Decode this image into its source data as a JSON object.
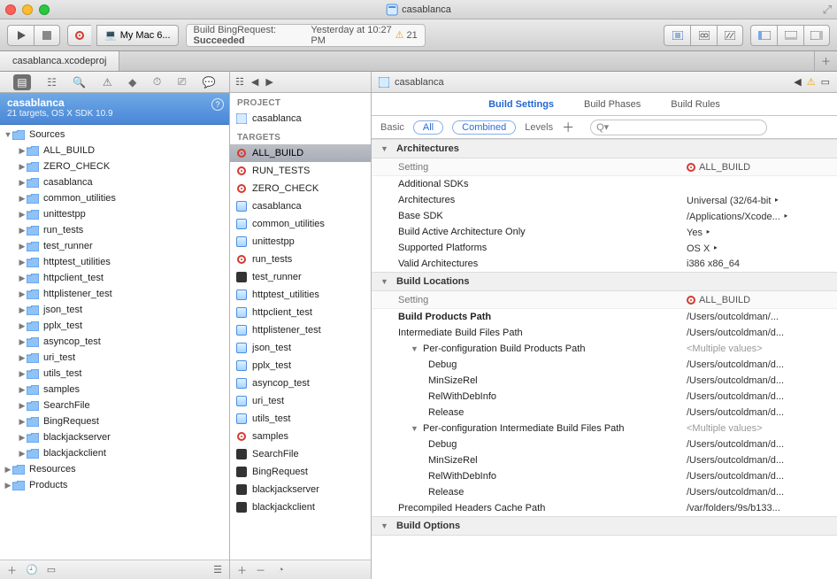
{
  "window": {
    "title": "casablanca"
  },
  "toolbar": {
    "scheme_target": "My Mac 6...",
    "activity_left": "Build BingRequest:",
    "activity_status": "Succeeded",
    "activity_right": "Yesterday at 10:27 PM",
    "warning_count": "21"
  },
  "tabbar": {
    "tab1": "casablanca.xcodeproj"
  },
  "navigator": {
    "project_name": "casablanca",
    "project_sub": "21 targets, OS X SDK 10.9",
    "tree": [
      {
        "label": "Sources",
        "depth": 1,
        "open": true,
        "icon": "folder"
      },
      {
        "label": "ALL_BUILD",
        "depth": 2,
        "icon": "folder"
      },
      {
        "label": "ZERO_CHECK",
        "depth": 2,
        "icon": "folder"
      },
      {
        "label": "casablanca",
        "depth": 2,
        "icon": "folder"
      },
      {
        "label": "common_utilities",
        "depth": 2,
        "icon": "folder"
      },
      {
        "label": "unittestpp",
        "depth": 2,
        "icon": "folder"
      },
      {
        "label": "run_tests",
        "depth": 2,
        "icon": "folder"
      },
      {
        "label": "test_runner",
        "depth": 2,
        "icon": "folder"
      },
      {
        "label": "httptest_utilities",
        "depth": 2,
        "icon": "folder"
      },
      {
        "label": "httpclient_test",
        "depth": 2,
        "icon": "folder"
      },
      {
        "label": "httplistener_test",
        "depth": 2,
        "icon": "folder"
      },
      {
        "label": "json_test",
        "depth": 2,
        "icon": "folder"
      },
      {
        "label": "pplx_test",
        "depth": 2,
        "icon": "folder"
      },
      {
        "label": "asyncop_test",
        "depth": 2,
        "icon": "folder"
      },
      {
        "label": "uri_test",
        "depth": 2,
        "icon": "folder"
      },
      {
        "label": "utils_test",
        "depth": 2,
        "icon": "folder"
      },
      {
        "label": "samples",
        "depth": 2,
        "icon": "folder"
      },
      {
        "label": "SearchFile",
        "depth": 2,
        "icon": "folder"
      },
      {
        "label": "BingRequest",
        "depth": 2,
        "icon": "folder"
      },
      {
        "label": "blackjackserver",
        "depth": 2,
        "icon": "folder"
      },
      {
        "label": "blackjackclient",
        "depth": 2,
        "icon": "folder"
      },
      {
        "label": "Resources",
        "depth": 1,
        "icon": "folder"
      },
      {
        "label": "Products",
        "depth": 1,
        "icon": "folder"
      }
    ]
  },
  "project_list": {
    "section_project": "PROJECT",
    "project_item": "casablanca",
    "section_targets": "TARGETS",
    "targets": [
      {
        "name": "ALL_BUILD",
        "icon": "red",
        "selected": true
      },
      {
        "name": "RUN_TESTS",
        "icon": "red"
      },
      {
        "name": "ZERO_CHECK",
        "icon": "red"
      },
      {
        "name": "casablanca",
        "icon": "app"
      },
      {
        "name": "common_utilities",
        "icon": "app"
      },
      {
        "name": "unittestpp",
        "icon": "app"
      },
      {
        "name": "run_tests",
        "icon": "red"
      },
      {
        "name": "test_runner",
        "icon": "cli"
      },
      {
        "name": "httptest_utilities",
        "icon": "app"
      },
      {
        "name": "httpclient_test",
        "icon": "app"
      },
      {
        "name": "httplistener_test",
        "icon": "app"
      },
      {
        "name": "json_test",
        "icon": "app"
      },
      {
        "name": "pplx_test",
        "icon": "app"
      },
      {
        "name": "asyncop_test",
        "icon": "app"
      },
      {
        "name": "uri_test",
        "icon": "app"
      },
      {
        "name": "utils_test",
        "icon": "app"
      },
      {
        "name": "samples",
        "icon": "red"
      },
      {
        "name": "SearchFile",
        "icon": "cli"
      },
      {
        "name": "BingRequest",
        "icon": "cli"
      },
      {
        "name": "blackjackserver",
        "icon": "cli"
      },
      {
        "name": "blackjackclient",
        "icon": "cli"
      }
    ]
  },
  "editor": {
    "jump_title": "casablanca",
    "tabs": {
      "build_settings": "Build Settings",
      "build_phases": "Build Phases",
      "build_rules": "Build Rules"
    },
    "filter": {
      "basic": "Basic",
      "all": "All",
      "combined": "Combined",
      "levels": "Levels",
      "search_placeholder": ""
    },
    "col_setting": "Setting",
    "col_target": "ALL_BUILD",
    "groups": [
      {
        "title": "Architectures",
        "rows": [
          {
            "k": "Additional SDKs",
            "v": ""
          },
          {
            "k": "Architectures",
            "v": "Universal (32/64-bit",
            "popup": true
          },
          {
            "k": "Base SDK",
            "v": "/Applications/Xcode...",
            "popup": true
          },
          {
            "k": "Build Active Architecture Only",
            "v": "Yes",
            "popup": true
          },
          {
            "k": "Supported Platforms",
            "v": "OS X",
            "popup": true
          },
          {
            "k": "Valid Architectures",
            "v": "i386 x86_64"
          }
        ]
      },
      {
        "title": "Build Locations",
        "rows": [
          {
            "k": "Build Products Path",
            "v": "/Users/outcoldman/...",
            "bold": true
          },
          {
            "k": "Intermediate Build Files Path",
            "v": "/Users/outcoldman/d..."
          },
          {
            "k": "Per-configuration Build Products Path",
            "v": "<Multiple values>",
            "muted": true,
            "disclose": true
          },
          {
            "k": "Debug",
            "v": "/Users/outcoldman/d...",
            "indent": 2
          },
          {
            "k": "MinSizeRel",
            "v": "/Users/outcoldman/d...",
            "indent": 2
          },
          {
            "k": "RelWithDebInfo",
            "v": "/Users/outcoldman/d...",
            "indent": 2
          },
          {
            "k": "Release",
            "v": "/Users/outcoldman/d...",
            "indent": 2
          },
          {
            "k": "Per-configuration Intermediate Build Files Path",
            "v": "<Multiple values>",
            "muted": true,
            "disclose": true
          },
          {
            "k": "Debug",
            "v": "/Users/outcoldman/d...",
            "indent": 2
          },
          {
            "k": "MinSizeRel",
            "v": "/Users/outcoldman/d...",
            "indent": 2
          },
          {
            "k": "RelWithDebInfo",
            "v": "/Users/outcoldman/d...",
            "indent": 2
          },
          {
            "k": "Release",
            "v": "/Users/outcoldman/d...",
            "indent": 2
          },
          {
            "k": "Precompiled Headers Cache Path",
            "v": "/var/folders/9s/b133..."
          }
        ]
      },
      {
        "title": "Build Options",
        "rows": []
      }
    ]
  },
  "icons": {
    "search_glyph": "Q▾"
  }
}
